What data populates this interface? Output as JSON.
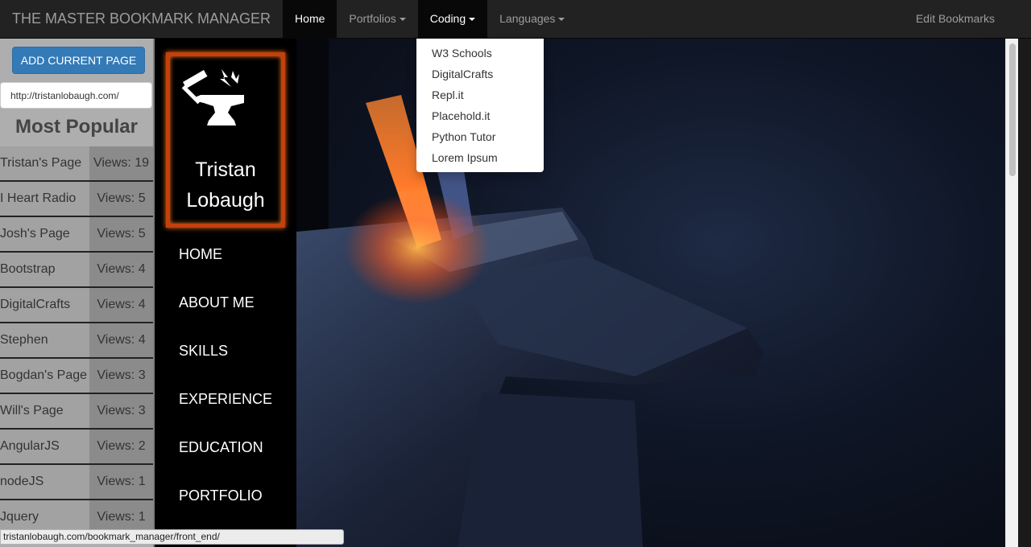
{
  "navbar": {
    "brand": "THE MASTER BOOKMARK MANAGER",
    "items": [
      {
        "label": "Home",
        "dropdown": false
      },
      {
        "label": "Portfolios",
        "dropdown": true
      },
      {
        "label": "Coding",
        "dropdown": true
      },
      {
        "label": "Languages",
        "dropdown": true
      }
    ],
    "right_link": "Edit Bookmarks"
  },
  "coding_menu": {
    "items": [
      "W3 Schools",
      "DigitalCrafts",
      "Repl.it",
      "Placehold.it",
      "Python Tutor",
      "Lorem Ipsum"
    ]
  },
  "sidebar": {
    "add_button": "ADD CURRENT PAGE",
    "url_value": "http://tristanlobaugh.com/",
    "heading": "Most Popular",
    "popular": [
      {
        "name": "Tristan's Page",
        "views": "Views: 19"
      },
      {
        "name": "I Heart Radio",
        "views": "Views: 5"
      },
      {
        "name": "Josh's Page",
        "views": "Views: 5"
      },
      {
        "name": "Bootstrap",
        "views": "Views: 4"
      },
      {
        "name": "DigitalCrafts",
        "views": "Views: 4"
      },
      {
        "name": "Stephen",
        "views": "Views: 4"
      },
      {
        "name": "Bogdan's Page",
        "views": "Views: 3"
      },
      {
        "name": "Will's Page",
        "views": "Views: 3"
      },
      {
        "name": "AngularJS",
        "views": "Views: 2"
      },
      {
        "name": "nodeJS",
        "views": "Views: 1"
      },
      {
        "name": "Jquery",
        "views": "Views: 1"
      }
    ]
  },
  "site": {
    "logo_icon": "anvil-hammer-icon",
    "name_line1": "Tristan",
    "name_line2": "Lobaugh",
    "nav": [
      "HOME",
      "ABOUT ME",
      "SKILLS",
      "EXPERIENCE",
      "EDUCATION",
      "PORTFOLIO"
    ]
  },
  "hero": {
    "image": "anvil-with-glowing-metal"
  },
  "status_bar": {
    "url": "tristanlobaugh.com/bookmark_manager/front_end/"
  },
  "colors": {
    "navbar_bg": "#222222",
    "active_nav": "#080808",
    "button_blue": "#337ab7",
    "sidebar_gray": "#aeaeae",
    "logo_border": "#c2410c"
  }
}
